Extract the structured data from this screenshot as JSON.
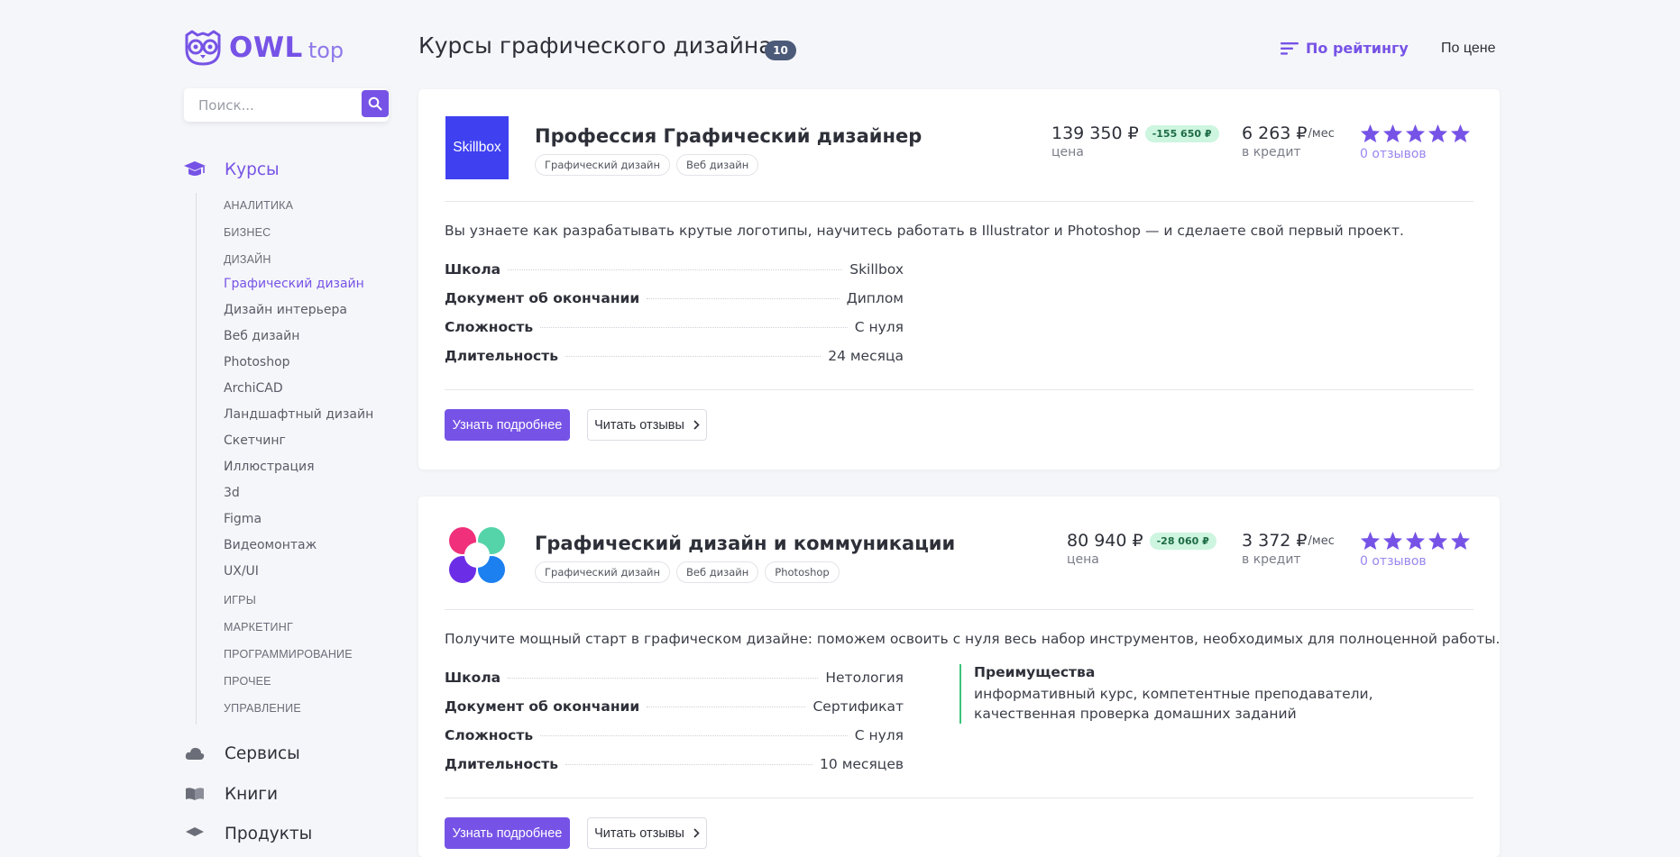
{
  "brand": {
    "name_bold": "OWL",
    "name_light": "top"
  },
  "search": {
    "placeholder": "Поиск..."
  },
  "sidebar": {
    "sections": [
      {
        "label": "Курсы",
        "icon": "graduation-cap-icon"
      },
      {
        "label": "Сервисы",
        "icon": "cloud-icon"
      },
      {
        "label": "Книги",
        "icon": "book-icon"
      },
      {
        "label": "Продукты",
        "icon": "layers-icon"
      }
    ],
    "items": [
      "АНАЛИТИКА",
      "БИЗНЕС",
      "ДИЗАЙН",
      "Графический дизайн",
      "Дизайн интерьера",
      "Веб дизайн",
      "Photoshop",
      "ArchiCAD",
      "Ландшафтный дизайн",
      "Скетчинг",
      "Иллюстрация",
      "3d",
      "Figma",
      "Видеомонтаж",
      "UX/UI",
      "ИГРЫ",
      "МАРКЕТИНГ",
      "ПРОГРАММИРОВАНИЕ",
      "ПРОЧЕЕ",
      "УПРАВЛЕНИЕ"
    ],
    "active_item": "Графический дизайн"
  },
  "header": {
    "title": "Курсы графического дизайна",
    "count": "10",
    "sort_rating": "По рейтингу",
    "sort_price": "По цене"
  },
  "colors": {
    "accent": "#7653e6",
    "discount_bg": "#cdf5df",
    "advantage_border": "#3cc37c",
    "badge": "#4b5a78"
  },
  "cards": [
    {
      "logo_text": "Skillbox",
      "title": "Профессия Графический дизайнер",
      "tags": [
        "Графический дизайн",
        "Веб дизайн"
      ],
      "price": "139 350 ₽",
      "discount": "-155 650 ₽",
      "price_caption": "цена",
      "credit": "6 263 ₽",
      "credit_unit": "/мес",
      "credit_caption": "в кредит",
      "rating_stars": 5,
      "reviews": "0 отзывов",
      "description": "Вы узнаете как разрабатывать крутые логотипы, научитесь работать в Illustrator и Photoshop — и сделаете свой первый проект.",
      "specs": [
        {
          "k": "Школа",
          "v": "Skillbox"
        },
        {
          "k": "Документ об окончании",
          "v": "Диплом"
        },
        {
          "k": "Сложность",
          "v": "С нуля"
        },
        {
          "k": "Длительность",
          "v": "24 месяца"
        }
      ],
      "btn_more": "Узнать подробнее",
      "btn_reviews": "Читать отзывы"
    },
    {
      "title": "Графический дизайн и коммуникации",
      "tags": [
        "Графический дизайн",
        "Веб дизайн",
        "Photoshop"
      ],
      "price": "80 940 ₽",
      "discount": "-28 060 ₽",
      "price_caption": "цена",
      "credit": "3 372 ₽",
      "credit_unit": "/мес",
      "credit_caption": "в кредит",
      "rating_stars": 5,
      "reviews": "0 отзывов",
      "description": "Получите мощный старт в графическом дизайне: поможем освоить с нуля весь набор инструментов, необходимых для полноценной работы.",
      "specs": [
        {
          "k": "Школа",
          "v": "Нетология"
        },
        {
          "k": "Документ об окончании",
          "v": "Сертификат"
        },
        {
          "k": "Сложность",
          "v": "С нуля"
        },
        {
          "k": "Длительность",
          "v": "10 месяцев"
        }
      ],
      "advantages_title": "Преимущества",
      "advantages_text": "информативный курс, компетентные преподаватели, качественная проверка домашних заданий",
      "btn_more": "Узнать подробнее",
      "btn_reviews": "Читать отзывы"
    }
  ]
}
